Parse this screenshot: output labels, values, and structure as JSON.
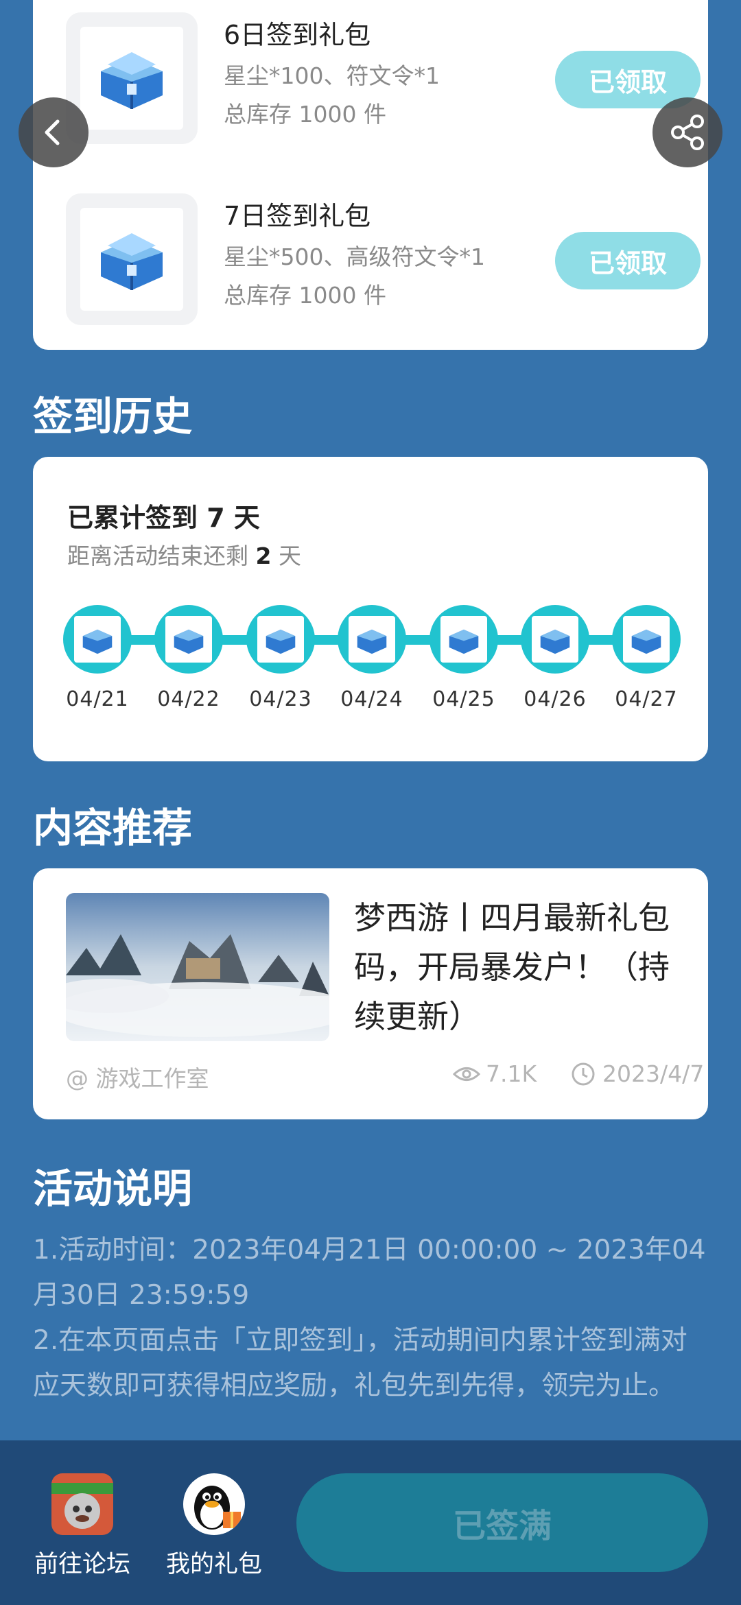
{
  "gifts": [
    {
      "title": "6日签到礼包",
      "desc": "星尘*100、符文令*1",
      "stock": "总库存 1000 件",
      "button": "已领取"
    },
    {
      "title": "7日签到礼包",
      "desc": "星尘*500、高级符文令*1",
      "stock": "总库存 1000 件",
      "button": "已领取"
    }
  ],
  "history": {
    "section_title": "签到历史",
    "count_prefix": "已累计签到 ",
    "count_value": "7",
    "count_suffix": " 天",
    "remain_prefix": "距离活动结束还剩 ",
    "remain_value": "2",
    "remain_suffix": " 天",
    "dates": [
      "04/21",
      "04/22",
      "04/23",
      "04/24",
      "04/25",
      "04/26",
      "04/27"
    ]
  },
  "recommend": {
    "section_title": "内容推荐",
    "article_title": "梦西游丨四月最新礼包码，开局暴发户！（持续更新）",
    "author": "@ 游戏工作室",
    "views": "7.1K",
    "date": "2023/4/7"
  },
  "description": {
    "section_title": "活动说明",
    "line1": "1.活动时间：2023年04月21日 00:00:00 ~ 2023年04月30日 23:59:59",
    "line2": "2.在本页面点击「立即签到」，活动期间内累计签到满对应天数即可获得相应奖励，礼包先到先得，领完为止。"
  },
  "bottom": {
    "forum_label": "前往论坛",
    "gift_label": "我的礼包",
    "signed_label": "已签满"
  },
  "colors": {
    "background": "#3673ac",
    "accent": "#21c3cf",
    "claimed_button": "#8fdde6",
    "bottom_bar": "#204a78"
  }
}
